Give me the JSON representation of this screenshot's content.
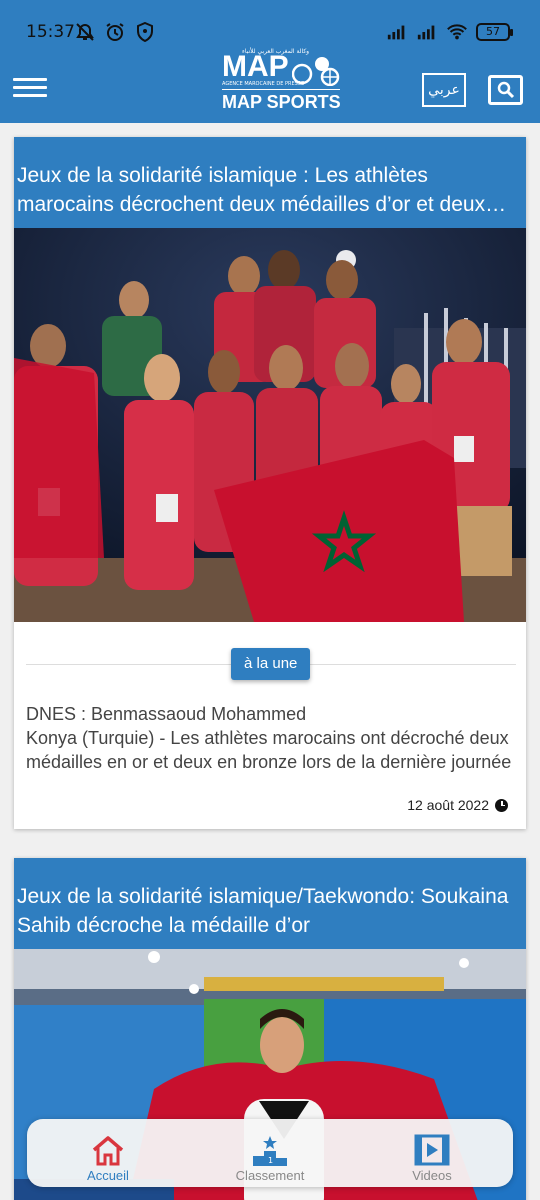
{
  "status_bar": {
    "time": "15:37",
    "battery": "57"
  },
  "header": {
    "logo_text": "MAP",
    "logo_subtitle": "MAP SPORTS",
    "logo_arabic": "وكالة المغرب العربي للأنباء",
    "logo_agency": "AGENCE MAROCAINE DE PRESSE",
    "lang_button": "عربي",
    "menu_icon": "hamburger-menu-icon",
    "search_icon": "search-icon"
  },
  "articles": [
    {
      "title": "Jeux de la solidarité islamique : Les athlètes marocains décrochent deux médailles d’or et deux médailles de bronze",
      "tag": "à la une",
      "author": "DNES : Benmassaoud Mohammed",
      "excerpt": "Konya (Turquie) - Les athlètes marocains ont décroché deux médailles en or et deux en bronze lors de la dernière journée",
      "date": "12 août 2022"
    },
    {
      "title": "Jeux de la solidarité islamique/Taekwondo: Soukaina Sahib décroche la médaille d’or"
    }
  ],
  "bottom_nav": {
    "items": [
      {
        "label": "Accueil",
        "icon": "home-icon",
        "active": true
      },
      {
        "label": "Classement",
        "icon": "podium-icon",
        "active": false
      },
      {
        "label": "Videos",
        "icon": "video-icon",
        "active": false
      }
    ]
  },
  "colors": {
    "primary": "#2f7ec0",
    "accent_active": "#d9363e"
  }
}
